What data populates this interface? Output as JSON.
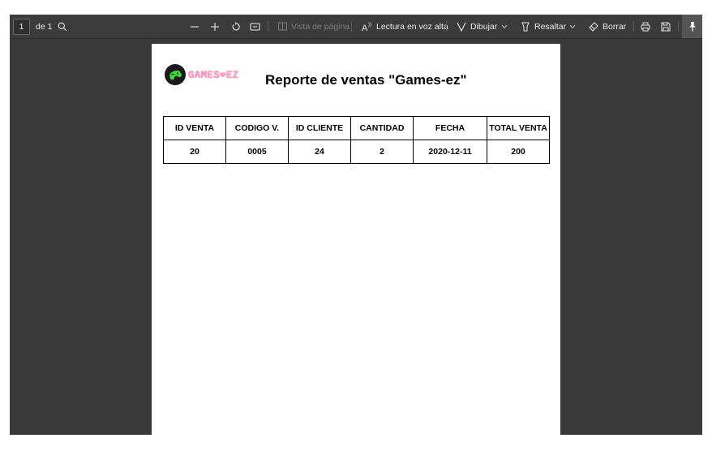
{
  "toolbar": {
    "page_current": "1",
    "page_total": "de 1",
    "page_view_label": "Vista de página",
    "read_aloud_label": "Lectura en voz alta",
    "draw_label": "Dibujar",
    "highlight_label": "Resaltar",
    "erase_label": "Borrar"
  },
  "icons": {
    "search": "search-icon",
    "zoom_out": "minus-icon",
    "zoom_in": "plus-icon",
    "rotate": "rotate-icon",
    "fit": "fit-page-icon",
    "page_view": "page-view-icon",
    "read_aloud": "read-aloud-icon",
    "draw": "draw-icon",
    "highlight": "highlighter-icon",
    "erase": "eraser-icon",
    "print": "print-icon",
    "save": "save-icon",
    "pin": "pin-icon"
  },
  "document": {
    "logo_text": "GAMES❤EZ",
    "title": "Reporte de ventas \"Games-ez\"",
    "table": {
      "headers": [
        "ID VENTA",
        "CODIGO V.",
        "ID CLIENTE",
        "CANTIDAD",
        "FECHA",
        "TOTAL VENTA"
      ],
      "rows": [
        [
          "20",
          "0005",
          "24",
          "2",
          "2020-12-11",
          "200"
        ]
      ]
    }
  },
  "colors": {
    "toolbar_bg": "#3b3b3b",
    "viewer_bg": "#393939",
    "logo_green": "#3ddc3d",
    "logo_pink": "#f2a6c4"
  }
}
